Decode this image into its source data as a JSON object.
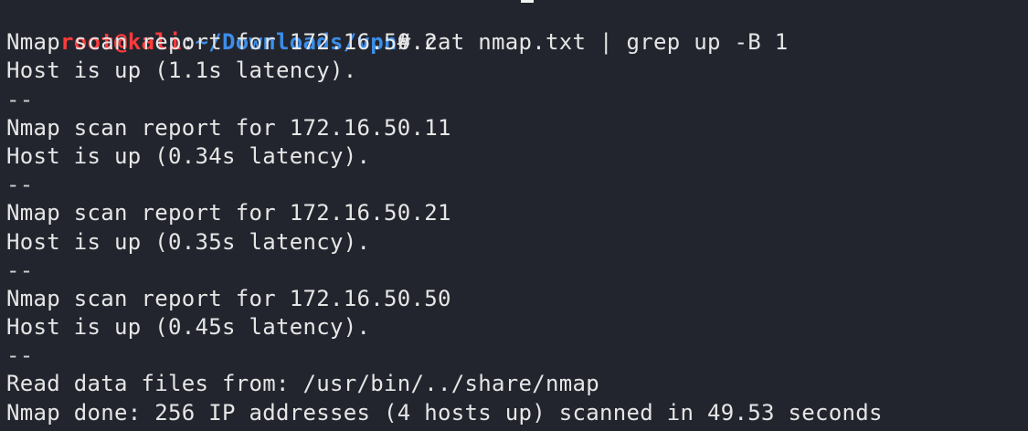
{
  "prompt": {
    "user_host": "root@kali",
    "colon": ":",
    "path": "~/Downloads/vpn",
    "symbol": "#",
    "command": " cat nmap.txt | grep up -B 1"
  },
  "output": [
    "Nmap scan report for 172.16.50.2",
    "Host is up (1.1s latency).",
    "--",
    "Nmap scan report for 172.16.50.11",
    "Host is up (0.34s latency).",
    "--",
    "Nmap scan report for 172.16.50.21",
    "Host is up (0.35s latency).",
    "--",
    "Nmap scan report for 172.16.50.50",
    "Host is up (0.45s latency).",
    "--",
    "Read data files from: /usr/bin/../share/nmap",
    "Nmap done: 256 IP addresses (4 hosts up) scanned in 49.53 seconds"
  ],
  "colors": {
    "background": "#23252e",
    "text": "#e6e6e6",
    "user_host": "#ff3b3b",
    "path": "#3b8eea"
  }
}
